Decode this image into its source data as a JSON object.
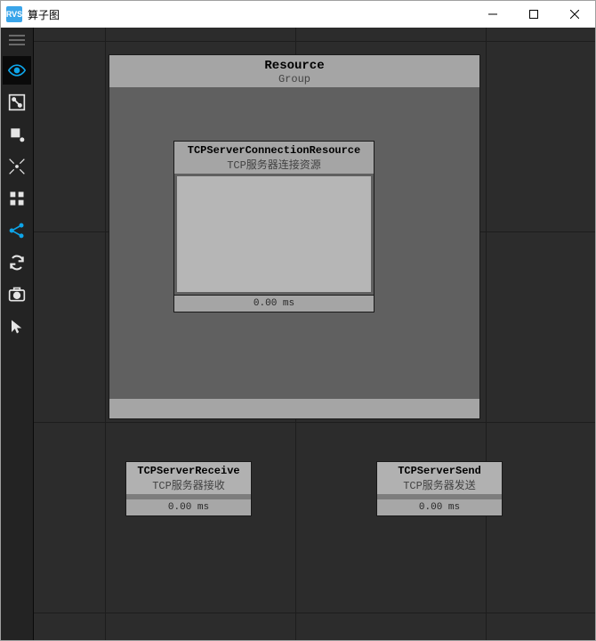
{
  "window": {
    "title": "算子图",
    "icon_text": "RVS"
  },
  "toolbar": {
    "items": [
      {
        "name": "eye-icon"
      },
      {
        "name": "graph-icon"
      },
      {
        "name": "node-icon"
      },
      {
        "name": "center-icon"
      },
      {
        "name": "app-grid-icon"
      },
      {
        "name": "share-icon"
      },
      {
        "name": "refresh-icon"
      },
      {
        "name": "camera-icon"
      },
      {
        "name": "select-icon"
      }
    ]
  },
  "canvas": {
    "group": {
      "name": "Resource",
      "sub": "Group",
      "inner_node": {
        "name": "TCPServerConnectionResource",
        "sub": "TCP服务器连接资源",
        "time": "0.00 ms"
      }
    },
    "node_recv": {
      "name": "TCPServerReceive",
      "sub": "TCP服务器接收",
      "time": "0.00 ms"
    },
    "node_send": {
      "name": "TCPServerSend",
      "sub": "TCP服务器发送",
      "time": "0.00 ms"
    }
  }
}
